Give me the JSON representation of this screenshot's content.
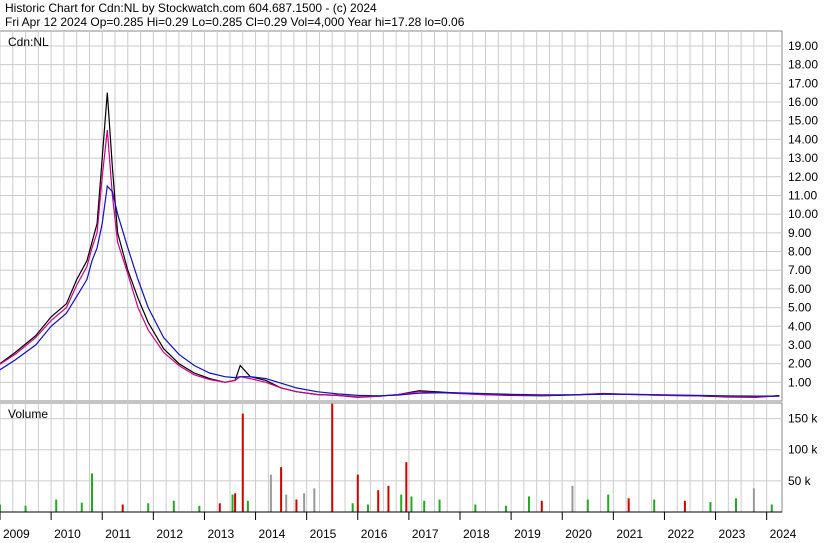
{
  "header": {
    "line1": "Historic Chart for Cdn:NL by Stockwatch.com 604.687.1500 - (c) 2024",
    "line2": "Fri Apr 12 2024   Op=0.285   Hi=0.29   Lo=0.285   Cl=0.29   Vol=4,000   Year hi=17.28   lo=0.06"
  },
  "chart_data": [
    {
      "type": "line",
      "title": "Cdn:NL",
      "ylim": [
        0,
        19.8
      ],
      "yticks": [
        "1.00",
        "2.00",
        "3.00",
        "4.00",
        "5.00",
        "6.00",
        "7.00",
        "8.00",
        "9.00",
        "10.00",
        "11.00",
        "12.00",
        "13.00",
        "14.00",
        "15.00",
        "16.00",
        "17.00",
        "18.00",
        "19.00"
      ],
      "x": [
        2008.9,
        2009.3,
        2009.7,
        2010.0,
        2010.3,
        2010.5,
        2010.7,
        2010.8,
        2010.9,
        2011.0,
        2011.1,
        2011.2,
        2011.3,
        2011.5,
        2011.7,
        2011.9,
        2012.2,
        2012.5,
        2012.8,
        2013.1,
        2013.4,
        2013.6,
        2013.7,
        2013.9,
        2014.2,
        2014.5,
        2014.8,
        2015.2,
        2015.6,
        2016.0,
        2016.4,
        2016.8,
        2017.2,
        2017.8,
        2018.4,
        2019.0,
        2019.6,
        2020.2,
        2020.8,
        2021.4,
        2022.0,
        2022.6,
        2023.2,
        2023.8,
        2024.25
      ],
      "series": [
        {
          "values": [
            1.8,
            2.6,
            3.5,
            4.5,
            5.2,
            6.5,
            7.5,
            8.5,
            9.5,
            13.0,
            16.5,
            12.5,
            9.0,
            7.0,
            5.5,
            4.2,
            2.8,
            2.0,
            1.5,
            1.2,
            1.0,
            1.1,
            1.9,
            1.3,
            1.1,
            0.7,
            0.5,
            0.35,
            0.3,
            0.2,
            0.25,
            0.35,
            0.55,
            0.45,
            0.35,
            0.3,
            0.28,
            0.32,
            0.4,
            0.35,
            0.3,
            0.28,
            0.22,
            0.2,
            0.29
          ],
          "color": "#000000"
        },
        {
          "values": [
            1.8,
            2.5,
            3.4,
            4.3,
            5.0,
            6.2,
            7.2,
            8.2,
            9.0,
            12.0,
            14.5,
            11.0,
            8.5,
            6.8,
            5.0,
            3.8,
            2.6,
            1.9,
            1.4,
            1.15,
            1.0,
            1.1,
            1.3,
            1.2,
            1.0,
            0.7,
            0.5,
            0.35,
            0.3,
            0.22,
            0.25,
            0.35,
            0.5,
            0.42,
            0.35,
            0.32,
            0.3,
            0.33,
            0.38,
            0.35,
            0.3,
            0.28,
            0.24,
            0.22,
            0.26
          ],
          "color": "#cc0088"
        },
        {
          "values": [
            1.5,
            2.2,
            3.0,
            4.0,
            4.7,
            5.6,
            6.5,
            7.5,
            8.2,
            9.5,
            11.5,
            11.2,
            10.0,
            8.2,
            6.5,
            5.0,
            3.4,
            2.5,
            1.9,
            1.5,
            1.3,
            1.25,
            1.3,
            1.3,
            1.2,
            0.95,
            0.7,
            0.5,
            0.38,
            0.3,
            0.28,
            0.32,
            0.42,
            0.45,
            0.4,
            0.36,
            0.33,
            0.33,
            0.36,
            0.36,
            0.33,
            0.3,
            0.28,
            0.26,
            0.27
          ],
          "color": "#1010c0"
        }
      ]
    },
    {
      "type": "bar",
      "title": "Volume",
      "yticks": [
        "50 k",
        "100 k",
        "150 k"
      ],
      "ylim": [
        0,
        175000
      ],
      "x": [
        2009.0,
        2009.5,
        2010.1,
        2010.6,
        2010.8,
        2011.4,
        2011.9,
        2012.4,
        2012.9,
        2013.3,
        2013.55,
        2013.6,
        2013.75,
        2013.85,
        2014.3,
        2014.5,
        2014.6,
        2014.8,
        2014.95,
        2015.15,
        2015.5,
        2015.9,
        2016.0,
        2016.2,
        2016.4,
        2016.6,
        2016.85,
        2016.95,
        2017.05,
        2017.3,
        2017.6,
        2018.3,
        2018.9,
        2019.35,
        2019.6,
        2020.2,
        2020.5,
        2020.9,
        2021.3,
        2021.8,
        2022.4,
        2022.9,
        2023.4,
        2023.75,
        2024.1
      ],
      "values": [
        12000,
        10000,
        20000,
        15000,
        62000,
        12000,
        14000,
        18000,
        10000,
        14000,
        28000,
        30000,
        158000,
        18000,
        60000,
        72000,
        28000,
        20000,
        30000,
        38000,
        174000,
        14000,
        60000,
        12000,
        35000,
        42000,
        28000,
        80000,
        25000,
        18000,
        20000,
        12000,
        10000,
        25000,
        18000,
        42000,
        20000,
        28000,
        22000,
        20000,
        18000,
        16000,
        22000,
        38000,
        12000
      ],
      "colors": [
        "#22aa22",
        "#22aa22",
        "#22aa22",
        "#22aa22",
        "#22aa22",
        "#cc0000",
        "#22aa22",
        "#22aa22",
        "#22aa22",
        "#cc0000",
        "#22aa22",
        "#cc0000",
        "#cc0000",
        "#22aa22",
        "#999999",
        "#cc0000",
        "#999999",
        "#cc0000",
        "#999999",
        "#999999",
        "#cc0000",
        "#22aa22",
        "#cc0000",
        "#22aa22",
        "#cc0000",
        "#cc0000",
        "#22aa22",
        "#cc0000",
        "#22aa22",
        "#22aa22",
        "#22aa22",
        "#22aa22",
        "#22aa22",
        "#22aa22",
        "#cc0000",
        "#999999",
        "#22aa22",
        "#22aa22",
        "#cc0000",
        "#22aa22",
        "#cc0000",
        "#22aa22",
        "#22aa22",
        "#999999",
        "#22aa22"
      ]
    }
  ],
  "x_axis": {
    "labels": [
      "2009",
      "2010",
      "2011",
      "2012",
      "2013",
      "2014",
      "2015",
      "2016",
      "2017",
      "2018",
      "2019",
      "2020",
      "2021",
      "2022",
      "2023",
      "2024"
    ],
    "start": 2009,
    "end": 2024.3
  }
}
